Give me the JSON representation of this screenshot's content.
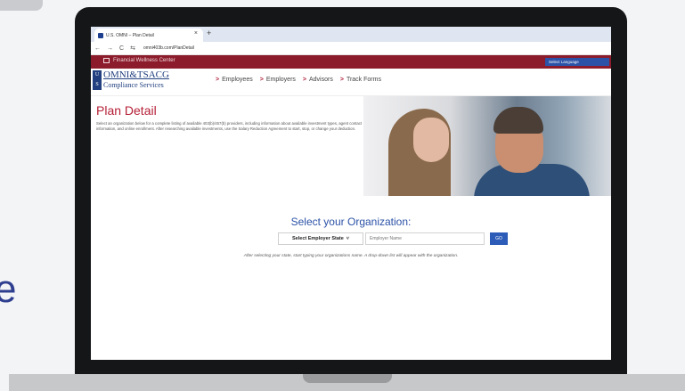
{
  "browser": {
    "tab_title": "U.S. OMNI – Plan Detail",
    "tab_close": "×",
    "new_tab": "+",
    "back": "←",
    "forward": "→",
    "reload": "C",
    "url": "omni403b.com/PlanDetail"
  },
  "topbar": {
    "title": "Financial Wellness Center",
    "language_label": "Select Language",
    "color": "#8c1c2c"
  },
  "logo": {
    "mark_top": "U",
    "mark_bottom": "S",
    "line1": "OMNI&TSACG",
    "line2": "Compliance Services"
  },
  "nav": {
    "arrow": ">",
    "items": [
      {
        "label": "Employees"
      },
      {
        "label": "Employers"
      },
      {
        "label": "Advisors"
      },
      {
        "label": "Track Forms"
      }
    ]
  },
  "page": {
    "title": "Plan Detail",
    "description": "Select an organization below for a complete listing of available 403(b)/457(b) providers, including information about available investment types, agent contact information, and online enrollment. After researching available investments, use the Salary Reduction Agreement to start, stop, or change your deduction."
  },
  "select_org": {
    "heading": "Select your Organization:",
    "state_label": "Select Employer State",
    "state_caret": "˅",
    "employer_placeholder": "Employer Name",
    "go_label": "GO",
    "hint": "After selecting your state, start typing your organizations name. A drop-down list will appear with the organization."
  },
  "colors": {
    "accent_red": "#b51f36",
    "accent_blue": "#2b51a7"
  }
}
